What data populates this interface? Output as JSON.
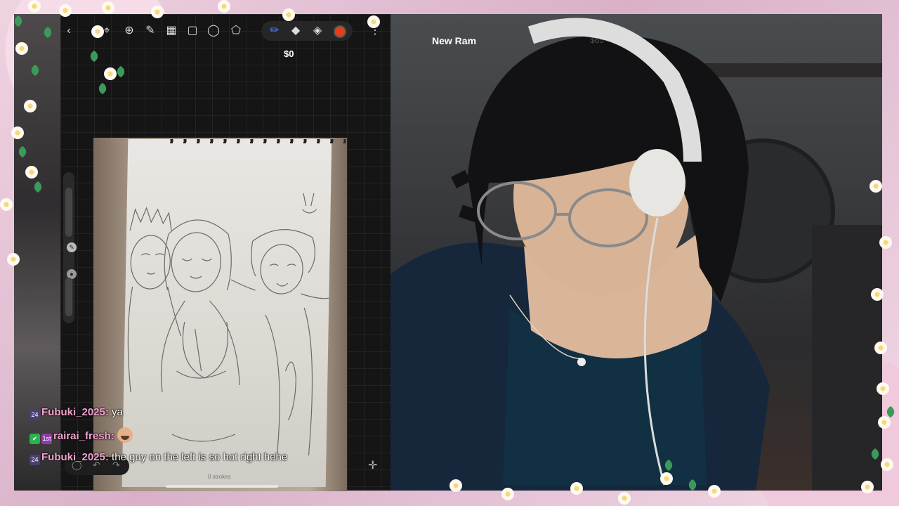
{
  "toolbar": {
    "money": "$0",
    "icons": [
      "back-icon",
      "move-icon",
      "adjust-icon",
      "pen-tool-icon",
      "grid-icon",
      "select-icon",
      "lasso-icon",
      "shape-icon",
      "brush-icon",
      "eraser-icon",
      "layers-icon",
      "color-icon",
      "more-icon"
    ]
  },
  "canvas": {
    "strokes_label": "0 strokes"
  },
  "webcam": {
    "name": "New Ram"
  },
  "chat": [
    {
      "badges": [
        "24"
      ],
      "user": "Fubuki_2025",
      "sep": ":",
      "message": "ya"
    },
    {
      "badges": [
        "check",
        "1st"
      ],
      "user": "rairai_fresh",
      "sep": ":",
      "message": ""
    },
    {
      "badges": [
        "24"
      ],
      "user": "Fubuki_2025",
      "sep": ":",
      "message": "the guy on the left is so hot right hehe"
    }
  ],
  "colors": {
    "accent_color": "#e0411c",
    "username": "#f2a3cf"
  }
}
